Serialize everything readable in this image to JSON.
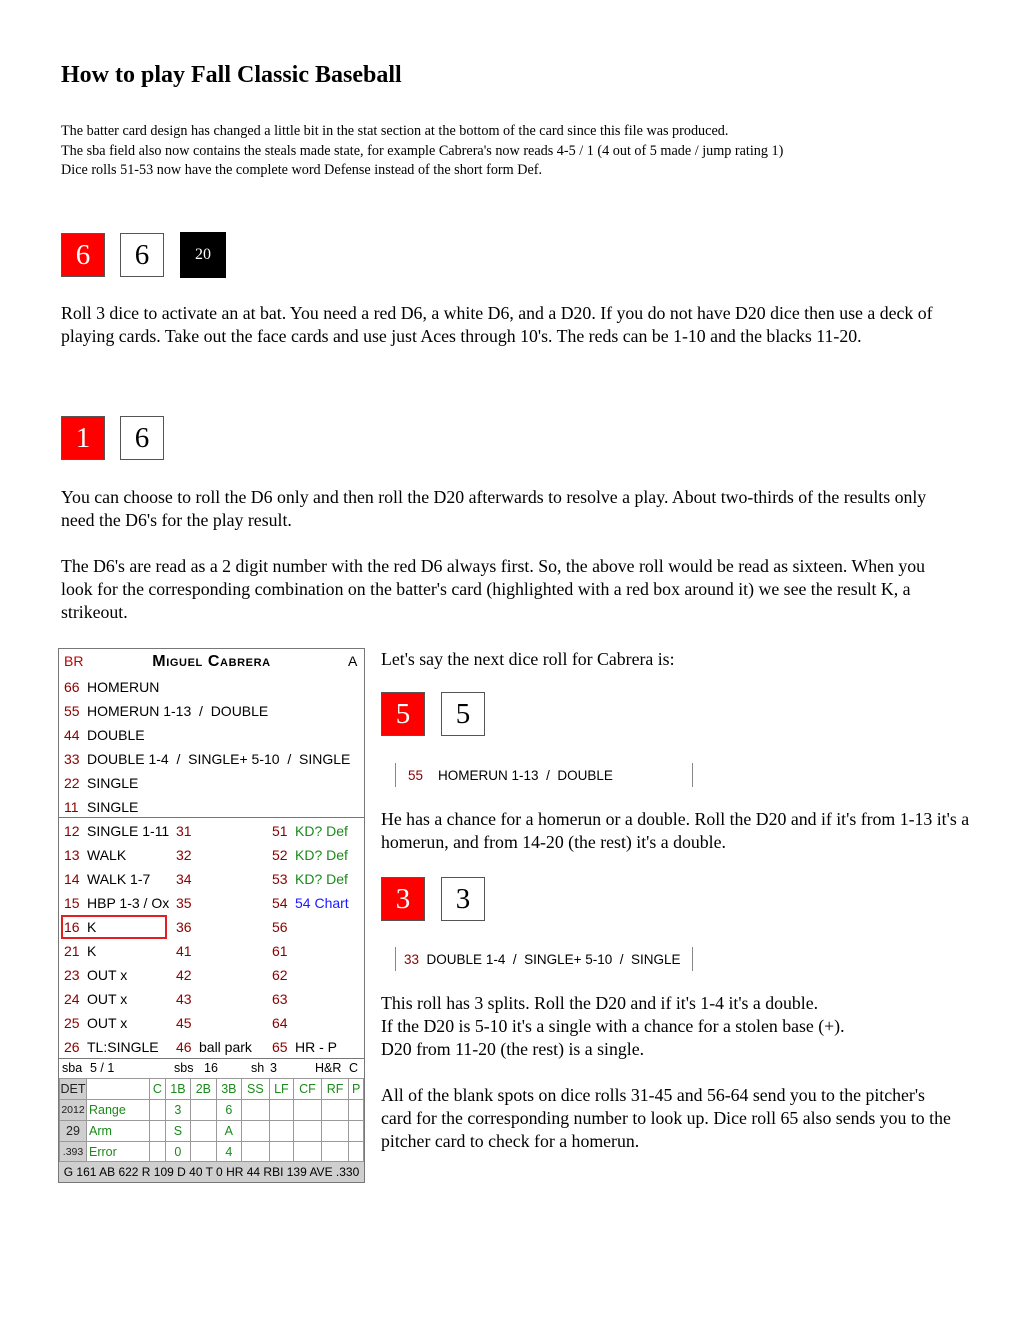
{
  "page_title": "How to play Fall Classic Baseball",
  "notes": [
    "The batter card design has changed a little bit in the stat section at the bottom of the card since this file was produced.",
    "The sba field also now contains the steals made state, for example Cabrera's now reads 4-5 / 1 (4 out of 5 made / jump rating 1)",
    "Dice rolls 51-53 now have the complete word Defense instead of the short form Def."
  ],
  "dice_set_1": {
    "red": "6",
    "white": "6",
    "d20": "20"
  },
  "para_roll3": "Roll 3 dice to activate an at bat.  You need a red D6, a white D6, and a D20.  If you do not have D20 dice then use a deck of playing cards.  Take out the face cards and use just Aces through 10's.  The reds can be 1-10 and the blacks 11-20.",
  "dice_set_2": {
    "red": "1",
    "white": "6"
  },
  "para_d6_only": "You can choose to roll the D6 only and then roll the D20 afterwards to resolve a play.  About two-thirds of the results only need the D6's for the play result.",
  "para_read": "The D6's are read as a 2 digit number with the red D6 always first.  So, the above roll would be read as sixteen. When you look for the corresponding combination on the batter's card (highlighted with a red box around it) we see the result K, a strikeout.",
  "card": {
    "bats": "BR",
    "player_name": "Miguel Cabrera",
    "grade": "A",
    "top_rows": [
      {
        "num": "66",
        "result": "HOMERUN"
      },
      {
        "num": "55",
        "result": "HOMERUN 1-13  /  DOUBLE"
      },
      {
        "num": "44",
        "result": "DOUBLE"
      },
      {
        "num": "33",
        "result": "DOUBLE 1-4  /  SINGLE+ 5-10  /  SINGLE"
      },
      {
        "num": "22",
        "result": "SINGLE"
      },
      {
        "num": "11",
        "result": "SINGLE"
      }
    ],
    "grid_rows": [
      [
        {
          "num": "12",
          "result": "SINGLE 1-11"
        },
        {
          "num": "31",
          "result": ""
        },
        {
          "num": "51",
          "result": "KD? Def"
        }
      ],
      [
        {
          "num": "13",
          "result": "WALK"
        },
        {
          "num": "32",
          "result": ""
        },
        {
          "num": "52",
          "result": "KD? Def"
        }
      ],
      [
        {
          "num": "14",
          "result": "WALK 1-7"
        },
        {
          "num": "34",
          "result": ""
        },
        {
          "num": "53",
          "result": "KD? Def"
        }
      ],
      [
        {
          "num": "15",
          "result": "HBP 1-3 / Ox"
        },
        {
          "num": "35",
          "result": ""
        },
        {
          "num": "54",
          "result": "54 Chart"
        }
      ],
      [
        {
          "num": "16",
          "result": "K"
        },
        {
          "num": "36",
          "result": ""
        },
        {
          "num": "56",
          "result": ""
        }
      ],
      [
        {
          "num": "21",
          "result": "K"
        },
        {
          "num": "41",
          "result": ""
        },
        {
          "num": "61",
          "result": ""
        }
      ],
      [
        {
          "num": "23",
          "result": "OUT x"
        },
        {
          "num": "42",
          "result": ""
        },
        {
          "num": "62",
          "result": ""
        }
      ],
      [
        {
          "num": "24",
          "result": "OUT x"
        },
        {
          "num": "43",
          "result": ""
        },
        {
          "num": "63",
          "result": ""
        }
      ],
      [
        {
          "num": "25",
          "result": "OUT x"
        },
        {
          "num": "45",
          "result": ""
        },
        {
          "num": "64",
          "result": ""
        }
      ],
      [
        {
          "num": "26",
          "result": "TL:SINGLE"
        },
        {
          "num": "46",
          "result": "ball park"
        },
        {
          "num": "65",
          "result": "HR - P"
        }
      ]
    ],
    "highlighted_roll": "16",
    "steal_line": {
      "sba_label": "sba",
      "sba": "5 / 1",
      "sbs_label": "sbs",
      "sbs": "16",
      "sh_label": "sh",
      "sh": "3",
      "hr_label": "H&R",
      "hr": "C"
    },
    "defense": {
      "team": "DET",
      "positions": [
        "C",
        "1B",
        "2B",
        "3B",
        "SS",
        "LF",
        "CF",
        "RF",
        "P"
      ],
      "rows": [
        {
          "side": "2012",
          "label": "Range",
          "values": [
            "",
            "3",
            "",
            "6",
            "",
            "",
            "",
            "",
            ""
          ]
        },
        {
          "side": "29",
          "label": "Arm",
          "values": [
            "",
            "S",
            "",
            "A",
            "",
            "",
            "",
            "",
            ""
          ]
        },
        {
          "side": ".393",
          "label": "Error",
          "values": [
            "",
            "0",
            "",
            "4",
            "",
            "",
            "",
            "",
            ""
          ]
        }
      ]
    },
    "stats": "G 161  AB 622  R 109  D 40  T 0  HR 44  RBI 139  AVE .330"
  },
  "right": {
    "intro": "Let's say the next dice roll for Cabrera is:",
    "dice_a": {
      "red": "5",
      "white": "5"
    },
    "excerpt_a": {
      "num": "55",
      "result": "HOMERUN 1-13  /  DOUBLE"
    },
    "para_a": "He has a chance for a homerun or a double.  Roll the D20 and if it's from 1-13 it's a homerun, and from 14-20 (the rest) it's a double.",
    "dice_b": {
      "red": "3",
      "white": "3"
    },
    "excerpt_b": {
      "num": "33",
      "result": "DOUBLE 1-4  /  SINGLE+ 5-10  /  SINGLE"
    },
    "para_b": [
      "This roll has 3 splits.  Roll the D20 and if it's 1-4 it's a double.",
      "If the D20 is 5-10 it's a single with a chance for a stolen base (+).",
      "D20 from 11-20 (the rest) is a single."
    ],
    "para_c": "All of the blank spots on dice rolls 31-45 and 56-64 send you to the pitcher's card for the corresponding number to look up.  Dice roll 65 also sends you to the pitcher card to check for a homerun."
  }
}
